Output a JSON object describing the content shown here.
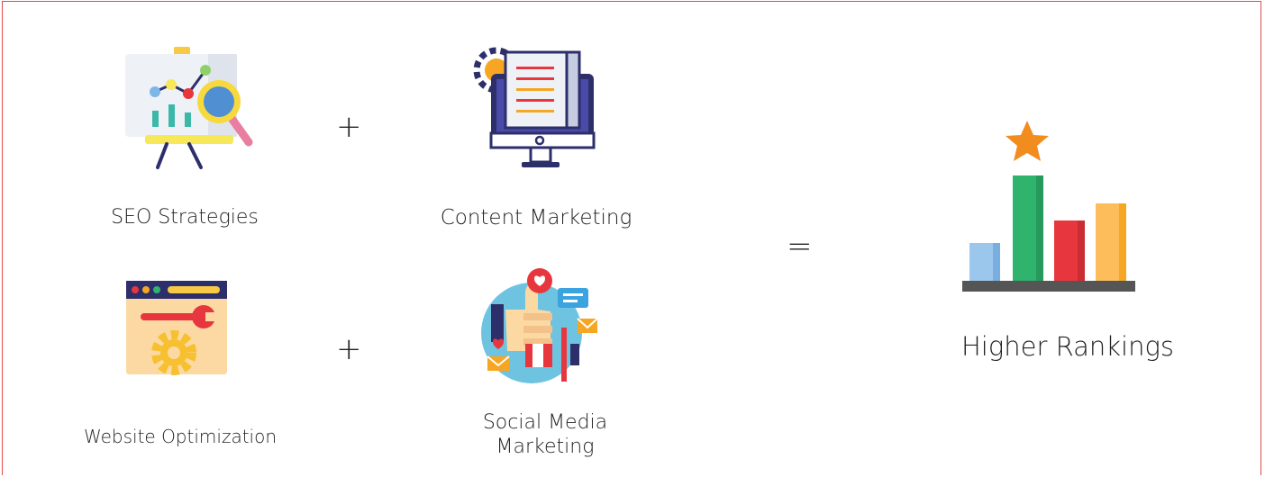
{
  "items": {
    "seo": {
      "label": "SEO Strategies",
      "icon": "seo-presentation-magnifier-icon"
    },
    "content": {
      "label": "Content Marketing",
      "icon": "monitor-document-gear-icon"
    },
    "website": {
      "label": "Website Optimization",
      "icon": "browser-wrench-gear-icon"
    },
    "social": {
      "label_line1": "Social Media",
      "label_line2": "Marketing",
      "icon": "social-thumbs-up-icon"
    },
    "result": {
      "label": "Higher Rankings",
      "icon": "bar-chart-star-icon"
    }
  },
  "operators": {
    "plus": "+",
    "equals": "="
  },
  "colors": {
    "border": "#e24b4b",
    "navy": "#2d2f6b",
    "green": "#2fb36d",
    "red": "#e8363e",
    "orange": "#f6a623",
    "blue": "#7fb6e8"
  }
}
